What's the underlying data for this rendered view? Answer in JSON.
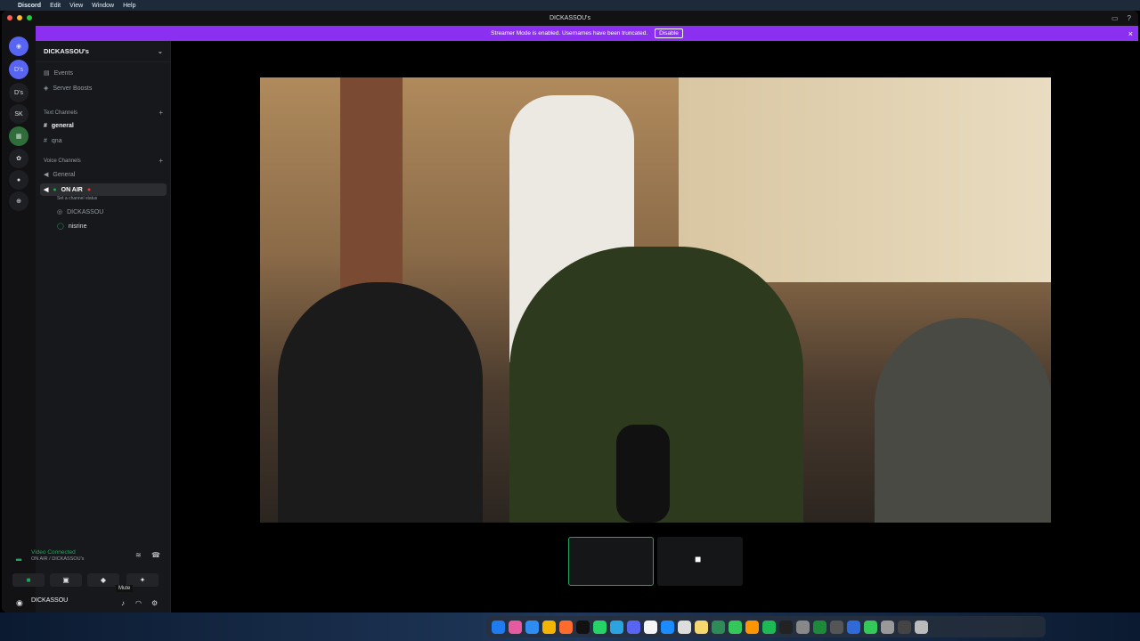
{
  "menubar": {
    "app": "Discord",
    "items": [
      "Edit",
      "View",
      "Window",
      "Help"
    ]
  },
  "window": {
    "title": "DICKASSOU's"
  },
  "banner": {
    "text": "Streamer Mode is enabled. Usernames have been truncated.",
    "button": "Disable"
  },
  "servers": [
    "D's",
    "D's",
    "SK"
  ],
  "sidebar": {
    "guild": "DICKASSOU's",
    "events": "Events",
    "boosts": "Server Boosts",
    "text_cat": "Text Channels",
    "text": [
      "general",
      "qna"
    ],
    "voice_cat": "Voice Channels",
    "voice_general": "General",
    "onair": "ON AIR",
    "status": "Set a channel status",
    "members": [
      "DICKASSOU",
      "nisrine"
    ]
  },
  "panel": {
    "connected": "Video Connected",
    "sub": "ON AIR / DICKASSOU's",
    "user": "DICKASSOU",
    "tooltip": "Mute"
  },
  "colors": {
    "accent": "#8b2ff0",
    "green": "#23a55a",
    "bg": "#17181b"
  }
}
